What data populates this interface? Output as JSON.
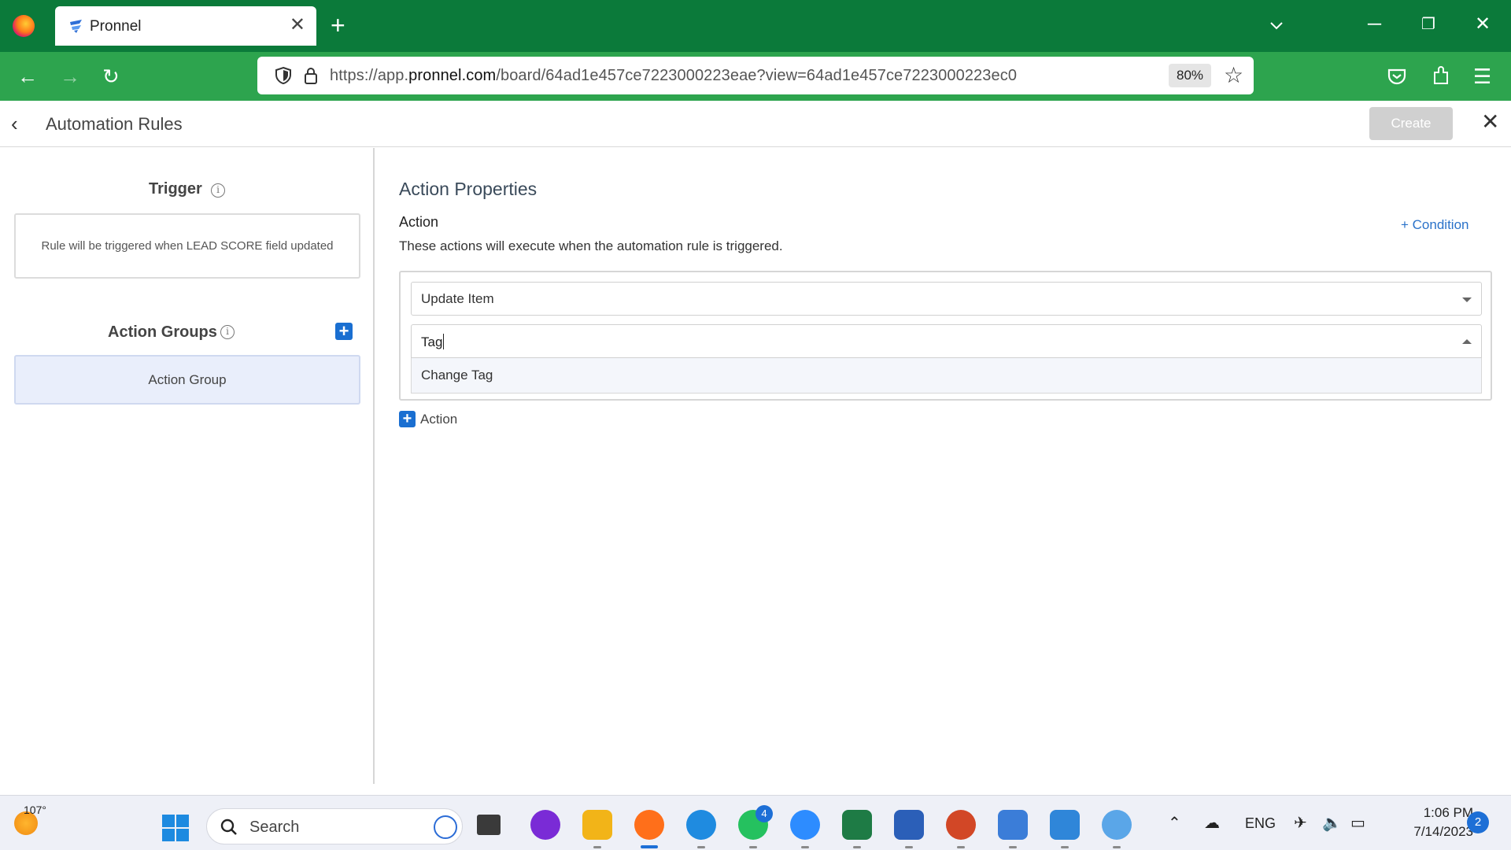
{
  "browser": {
    "tab_title": "Pronnel",
    "url_prefix": "https://app.",
    "url_domain": "pronnel.com",
    "url_path": "/board/64ad1e457ce7223000223eae?view=64ad1e457ce7223000223ec0",
    "zoom": "80%"
  },
  "header": {
    "title": "Automation Rules",
    "create_label": "Create"
  },
  "left": {
    "trigger_title": "Trigger",
    "trigger_text": "Rule will be triggered when LEAD SCORE field updated",
    "groups_title": "Action Groups",
    "group_item": "Action Group"
  },
  "right": {
    "title": "Action Properties",
    "action_label": "Action",
    "action_desc": "These actions will execute when the automation rule is triggered.",
    "condition_link": "+ Condition",
    "select_action_value": "Update Item",
    "search_value": "Tag",
    "dropdown_option": "Change Tag",
    "add_action_label": "Action"
  },
  "taskbar": {
    "temperature": "107°",
    "search_label": "Search",
    "whatsapp_badge": "4",
    "language": "ENG",
    "time": "1:06 PM",
    "date": "7/14/2023",
    "notifications": "2"
  },
  "colors": {
    "tabbar": "#0b7a3a",
    "navbar": "#2da44e",
    "accent_blue": "#1a6fd1",
    "link_blue": "#2a72c9",
    "group_card_bg": "#e9eefb"
  }
}
